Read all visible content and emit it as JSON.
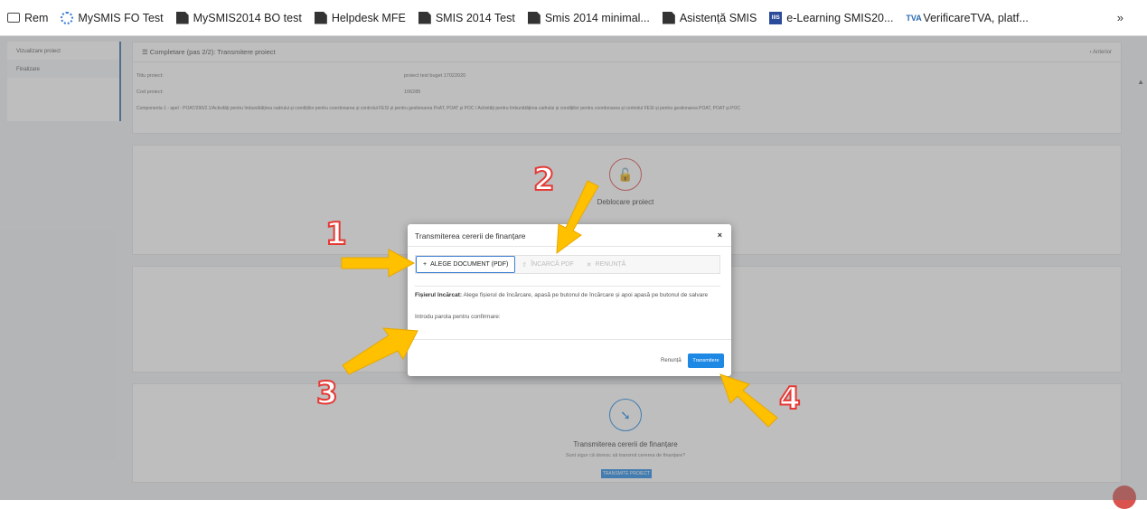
{
  "bookmarks": [
    {
      "icon": "folder-icon",
      "label": "Rem"
    },
    {
      "icon": "spinner-icon",
      "label": "MySMIS FO Test"
    },
    {
      "icon": "document-icon",
      "label": "MySMIS2014 BO test"
    },
    {
      "icon": "document-icon",
      "label": "Helpdesk MFE"
    },
    {
      "icon": "document-icon",
      "label": "SMIS 2014 Test"
    },
    {
      "icon": "document-icon",
      "label": "Smis 2014 minimal..."
    },
    {
      "icon": "document-icon",
      "label": "Asistență SMIS"
    },
    {
      "icon": "elearning-icon",
      "label": "e-Learning SMIS20..."
    },
    {
      "icon": "tva-icon",
      "label": "VerificareTVA, platf..."
    }
  ],
  "bookmarks_more": "»",
  "sidebar": {
    "items": [
      {
        "label": "Vizualizare proiect"
      },
      {
        "label": "Finalizare"
      }
    ]
  },
  "main": {
    "header_title": "☰ Completare (pas 2/2): Transmitere proiect",
    "header_right": "‹ Anterior",
    "fields": [
      {
        "label": "Titlu proiect:",
        "value": "proiect test buget 17022020"
      },
      {
        "label": "Cod proiect:",
        "value": "106285"
      }
    ],
    "component_text": "Componenta 1 - apel - POAT/290/2.1/Activități pentru îmbunătățirea cadrului și condițiilor pentru coordonarea și controlul FESI și pentru gestionarea PoAT, POAT și POC / Activități pentru îmbunătățirea cadrului și condițiilor pentru coordonarea și controlul FESI și pentru gestionarea POAT, POAT și POC",
    "panel_unlock_title": "Deblocare proiect",
    "panel_transmit_title": "Transmiterea cererii de finanțare",
    "panel_transmit_sub": "Sunt sigur că doresc să transmit cererea de finanțare?",
    "panel_transmit_button": "TRANSMITE PROIECT"
  },
  "modal": {
    "title": "Transmiterea cererii de finanțare",
    "close": "×",
    "steps": [
      {
        "symbol": "+",
        "label": "ALEGE DOCUMENT (PDF)",
        "active": true
      },
      {
        "symbol": "⇧",
        "label": "ÎNCARCĂ PDF",
        "active": false
      },
      {
        "symbol": "✕",
        "label": "RENUNȚĂ",
        "active": false
      }
    ],
    "file_label": "Fișierul încărcat:",
    "file_text": "Alege fișierul de încărcare, apasă pe butonul de încărcare și apoi apasă pe butonul de salvare",
    "password_label": "Introdu parola pentru confirmare:",
    "cancel_label": "Renunță",
    "submit_label": "Transmitere"
  },
  "annotations": {
    "n1": "1",
    "n2": "2",
    "n3": "3",
    "n4": "4",
    "arrow_color": "#FFC000",
    "number_color": "#E53935"
  }
}
